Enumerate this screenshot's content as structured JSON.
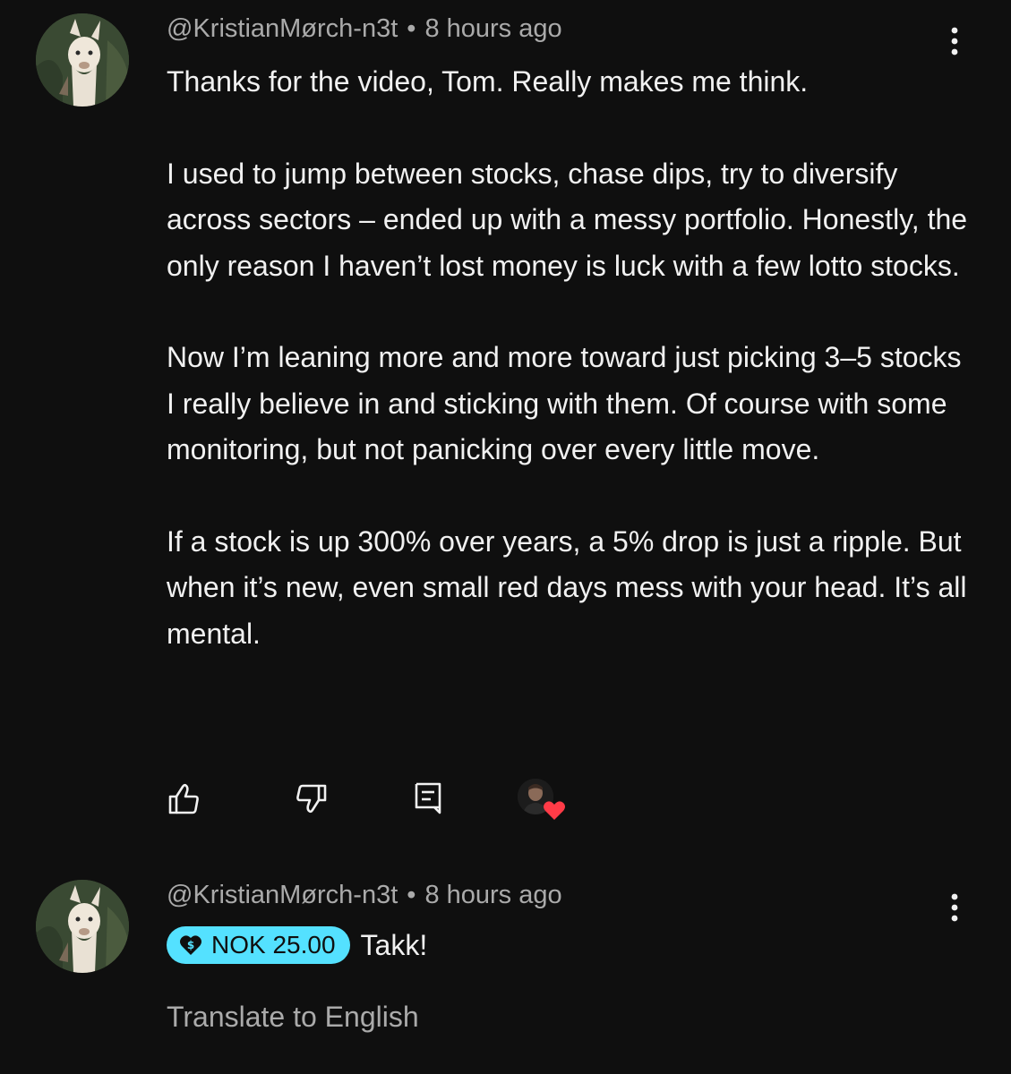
{
  "comments": [
    {
      "author": "@KristianMørch-n3t",
      "separator": "•",
      "time": "8 hours ago",
      "paragraphs": [
        "Thanks for the video, Tom. Really makes me think.",
        "I used to jump between stocks, chase dips, try to diversify across sectors – ended up with a messy portfolio. Honestly, the only reason I haven’t lost money is luck with a few lotto stocks.",
        "Now I’m leaning more and more toward just picking 3–5 stocks I really believe in and sticking with them. Of course with some monitoring, but not panicking over every little move.",
        "If a stock is up 300% over years, a 5% drop is just a ripple. But when it’s new, even small red days mess with your head. It’s all mental."
      ]
    },
    {
      "author": "@KristianMørch-n3t",
      "separator": "•",
      "time": "8 hours ago",
      "super_thanks_amount": "NOK 25.00",
      "text": "Takk!",
      "translate_label": "Translate to English"
    }
  ],
  "icons": {
    "more": "more-vertical-icon",
    "like": "thumbs-up-icon",
    "dislike": "thumbs-down-icon",
    "reply": "reply-comment-icon",
    "heart": "heart-icon",
    "super_thanks": "dollar-heart-icon"
  },
  "colors": {
    "background": "#0f0f0f",
    "text": "#f1f1f1",
    "muted": "#aaaaaa",
    "super_thanks_chip": "#54e1ff",
    "heart": "#ff3b47"
  }
}
